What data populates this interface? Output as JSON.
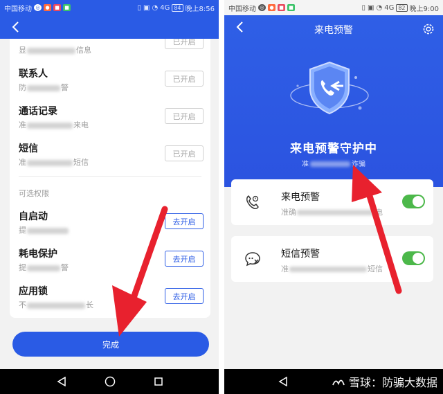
{
  "status_left": {
    "carrier": "中国移动",
    "signal": "4G",
    "battery": "84",
    "time": "晚上8:56"
  },
  "status_right": {
    "carrier": "中国移动",
    "signal": "4G",
    "battery": "82",
    "time": "晚上9:00"
  },
  "permissions": {
    "top_partial": {
      "desc_prefix": "显",
      "desc_suffix": "信息",
      "button": "已开启"
    },
    "enabled_items": [
      {
        "title": "联系人",
        "desc_prefix": "防",
        "desc_suffix": "警",
        "button": "已开启"
      },
      {
        "title": "通话记录",
        "desc_prefix": "准",
        "desc_suffix": "来电",
        "button": "已开启"
      },
      {
        "title": "短信",
        "desc_prefix": "准",
        "desc_suffix": "短信",
        "button": "已开启"
      }
    ],
    "optional_label": "可选权限",
    "optional_items": [
      {
        "title": "自启动",
        "desc_prefix": "提",
        "desc_suffix": "",
        "button": "去开启"
      },
      {
        "title": "耗电保护",
        "desc_prefix": "提",
        "desc_suffix": "警",
        "button": "去开启"
      },
      {
        "title": "应用锁",
        "desc_prefix": "不",
        "desc_suffix": "长",
        "button": "去开启"
      }
    ],
    "done_button": "完成"
  },
  "alerts_screen": {
    "title": "来电预警",
    "status": "来电预警守护中",
    "sub_prefix": "准",
    "sub_suffix": "诈骗",
    "items": [
      {
        "title": "来电预警",
        "desc_prefix": "准确",
        "desc_suffix": "电",
        "icon": "phone-alert-icon",
        "enabled": true
      },
      {
        "title": "短信预警",
        "desc_prefix": "准",
        "desc_suffix": "短信",
        "icon": "sms-alert-icon",
        "enabled": true
      }
    ]
  },
  "watermark": {
    "text": "雪球：防骗大数据"
  },
  "colors": {
    "brand_blue": "#2a5be5",
    "toggle_green": "#4cb84a",
    "arrow_red": "#e8212e"
  }
}
